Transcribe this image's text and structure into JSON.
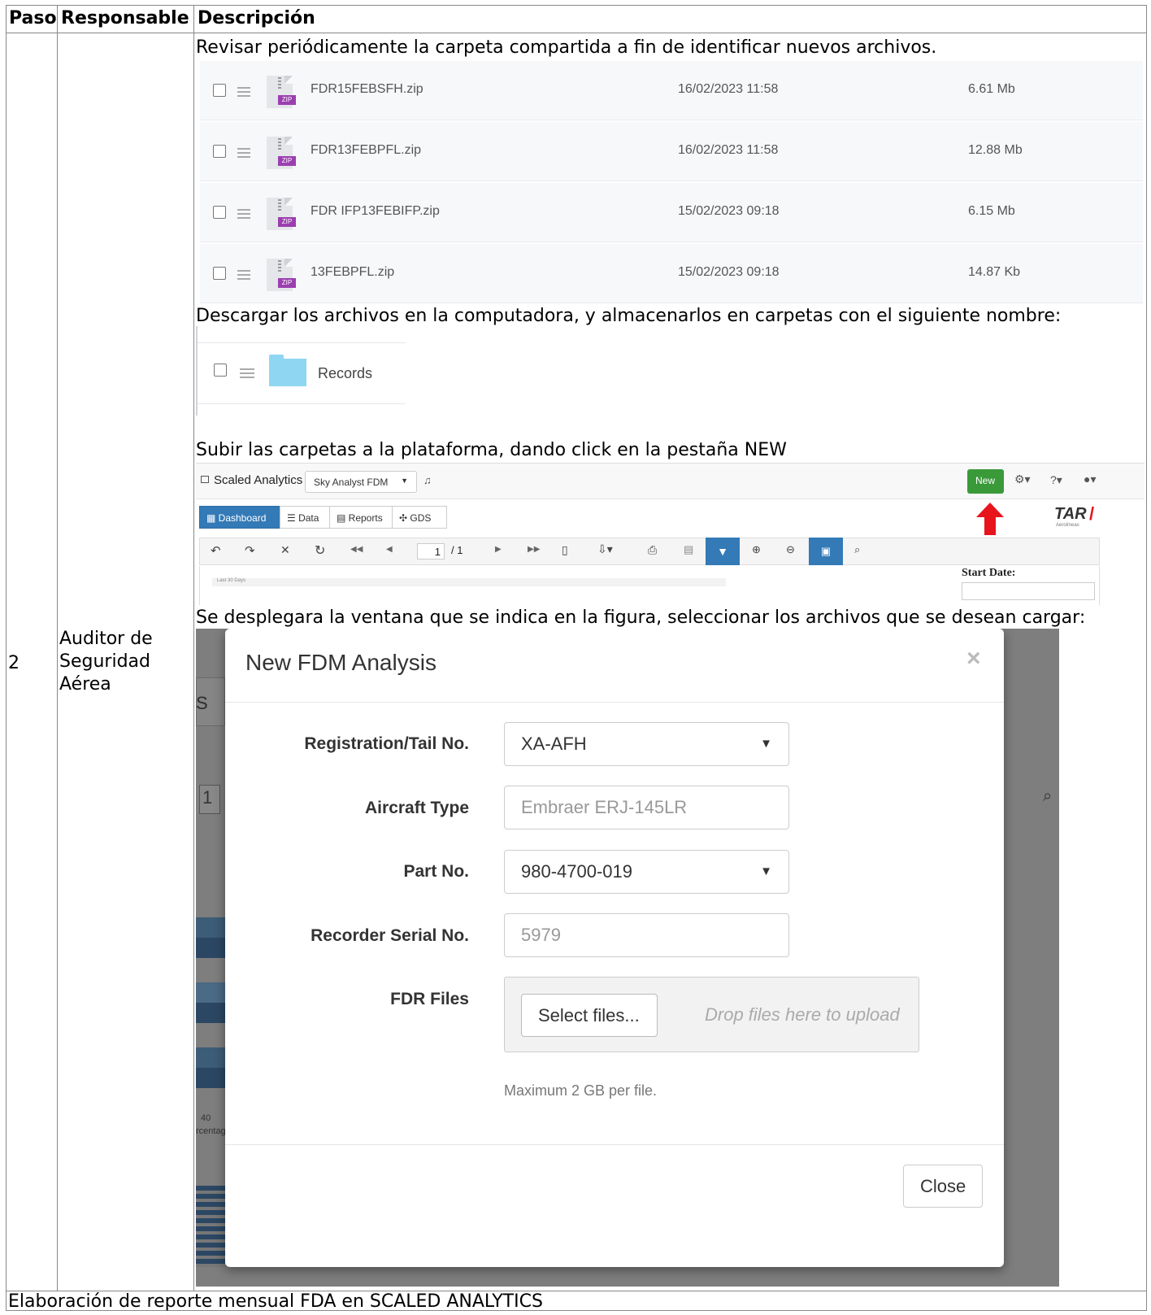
{
  "table": {
    "headers": [
      "Paso",
      "Responsable",
      "Descripción"
    ],
    "step": "2",
    "responsible": "Auditor de Seguridad Aérea",
    "footer": "Elaboración de reporte mensual FDA en SCALED ANALYTICS"
  },
  "instructions": {
    "review": "Revisar periódicamente la carpeta compartida a fin de identificar nuevos archivos.",
    "download": "Descargar los archivos en la computadora, y almacenarlos en carpetas con el siguiente nombre:",
    "upload": "Subir las carpetas a la plataforma, dando click en la pestaña NEW",
    "select": "Se desplegara la ventana que se indica en la figura, seleccionar los archivos que se desean cargar:"
  },
  "files": [
    {
      "name": "FDR15FEBSFH.zip",
      "date": "16/02/2023 11:58",
      "size": "6.61 Mb"
    },
    {
      "name": "FDR13FEBPFL.zip",
      "date": "16/02/2023 11:58",
      "size": "12.88 Mb"
    },
    {
      "name": "FDR IFP13FEBIFP.zip",
      "date": "15/02/2023 09:18",
      "size": "6.15 Mb"
    },
    {
      "name": "13FEBPFL.zip",
      "date": "15/02/2023 09:18",
      "size": "14.87 Kb"
    }
  ],
  "zip_tag": "ZIP",
  "folder": {
    "name": "Records",
    "icon": "folder-icon",
    "color": "#8fd6f2"
  },
  "platform": {
    "app_name": "Scaled Analytics",
    "selector": "Sky Analyst FDM",
    "new_button": "New",
    "help": "?",
    "tabs": [
      "Dashboard",
      "Data",
      "Reports",
      "GDS"
    ],
    "logo": "TAR",
    "logo_sub": "Aerolíneas",
    "page_current": "1",
    "page_total": "/ 1",
    "start_date_label": "Start Date:",
    "last_days": "Last 30 Days",
    "accent": "#337ab7",
    "new_color": "#3a9a3a",
    "arrow_color": "#e8141c"
  },
  "modal": {
    "title": "New FDM Analysis",
    "close_x": "×",
    "fields": {
      "registration_label": "Registration/Tail No.",
      "registration_value": "XA-AFH",
      "aircraft_label": "Aircraft Type",
      "aircraft_placeholder": "Embraer ERJ-145LR",
      "part_label": "Part No.",
      "part_value": "980-4700-019",
      "serial_label": "Recorder Serial No.",
      "serial_placeholder": "5979",
      "files_label": "FDR Files",
      "select_button": "Select files...",
      "drop_text": "Drop files here to upload",
      "note": "Maximum 2 GB per file."
    },
    "close_button": "Close"
  },
  "background_fragments": {
    "s": "S",
    "one": "1",
    "forty": "40",
    "pct": "rcentag"
  }
}
